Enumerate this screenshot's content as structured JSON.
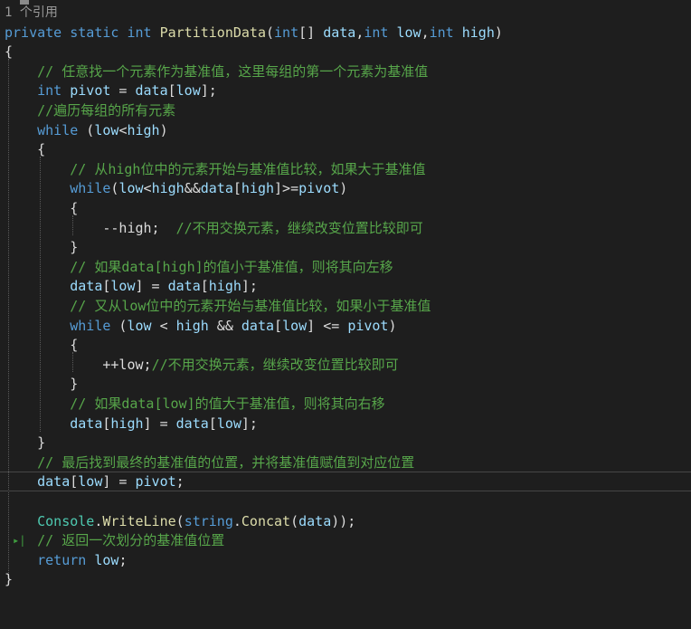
{
  "editor": {
    "codelens": "1 个引用",
    "comments": {
      "c1": "// 任意找一个元素作为基准值，这里每组的第一个元素为基准值",
      "c2": "//遍历每组的所有元素",
      "c3": "// 从high位中的元素开始与基准值比较，如果大于基准值",
      "c4": "//不用交换元素，继续改变位置比较即可",
      "c5": "// 如果data[high]的值小于基准值，则将其向左移",
      "c6": "// 又从low位中的元素开始与基准值比较，如果小于基准值",
      "c7": "//不用交换元素，继续改变位置比较即可",
      "c8": "// 如果data[low]的值大于基准值，则将其向右移",
      "c9": "// 最后找到最终的基准值的位置，并将基准值赋值到对应位置",
      "c10": "// 返回一次划分的基准值位置"
    },
    "tokens": {
      "private": "private",
      "static": "static",
      "int": "int",
      "method_name": "PartitionData",
      "param_data": "data",
      "param_low": "low",
      "param_high": "high",
      "pivot": "pivot",
      "while": "while",
      "return": "return",
      "Console": "Console",
      "WriteLine": "WriteLine",
      "string": "string",
      "Concat": "Concat",
      "dec_high": "--high;",
      "inc_low": "++low;"
    },
    "glyph": "▸|"
  }
}
